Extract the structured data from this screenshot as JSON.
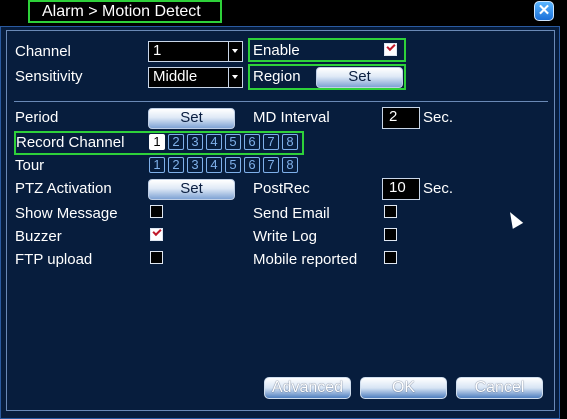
{
  "window": {
    "title": "Alarm > Motion Detect"
  },
  "fields": {
    "channel_label": "Channel",
    "channel_value": "1",
    "enable_label": "Enable",
    "enable_checked": true,
    "sensitivity_label": "Sensitivity",
    "sensitivity_value": "Middle",
    "region_label": "Region",
    "region_button": "Set",
    "period_label": "Period",
    "period_button": "Set",
    "md_interval_label": "MD Interval",
    "md_interval_value": "2",
    "md_interval_unit": "Sec.",
    "record_channel_label": "Record Channel",
    "tour_label": "Tour",
    "ptz_label": "PTZ Activation",
    "ptz_button": "Set",
    "postrec_label": "PostRec",
    "postrec_value": "10",
    "postrec_unit": "Sec."
  },
  "record_channels": {
    "c1": "1",
    "c2": "2",
    "c3": "3",
    "c4": "4",
    "c5": "5",
    "c6": "6",
    "c7": "7",
    "c8": "8",
    "selected": [
      1
    ]
  },
  "tour_channels": {
    "c1": "1",
    "c2": "2",
    "c3": "3",
    "c4": "4",
    "c5": "5",
    "c6": "6",
    "c7": "7",
    "c8": "8",
    "selected": []
  },
  "options": {
    "show_message": {
      "label": "Show Message",
      "checked": false
    },
    "send_email": {
      "label": "Send Email",
      "checked": false
    },
    "buzzer": {
      "label": "Buzzer",
      "checked": true
    },
    "write_log": {
      "label": "Write Log",
      "checked": false
    },
    "ftp_upload": {
      "label": "FTP upload",
      "checked": false
    },
    "mobile_reported": {
      "label": "Mobile reported",
      "checked": false
    }
  },
  "footer": {
    "advanced": "Advanced",
    "ok": "OK",
    "cancel": "Cancel"
  },
  "colors": {
    "dialog_bg": "#071d3d",
    "highlight": "#2ed13a",
    "channel_blue": "#7fb0ea"
  }
}
